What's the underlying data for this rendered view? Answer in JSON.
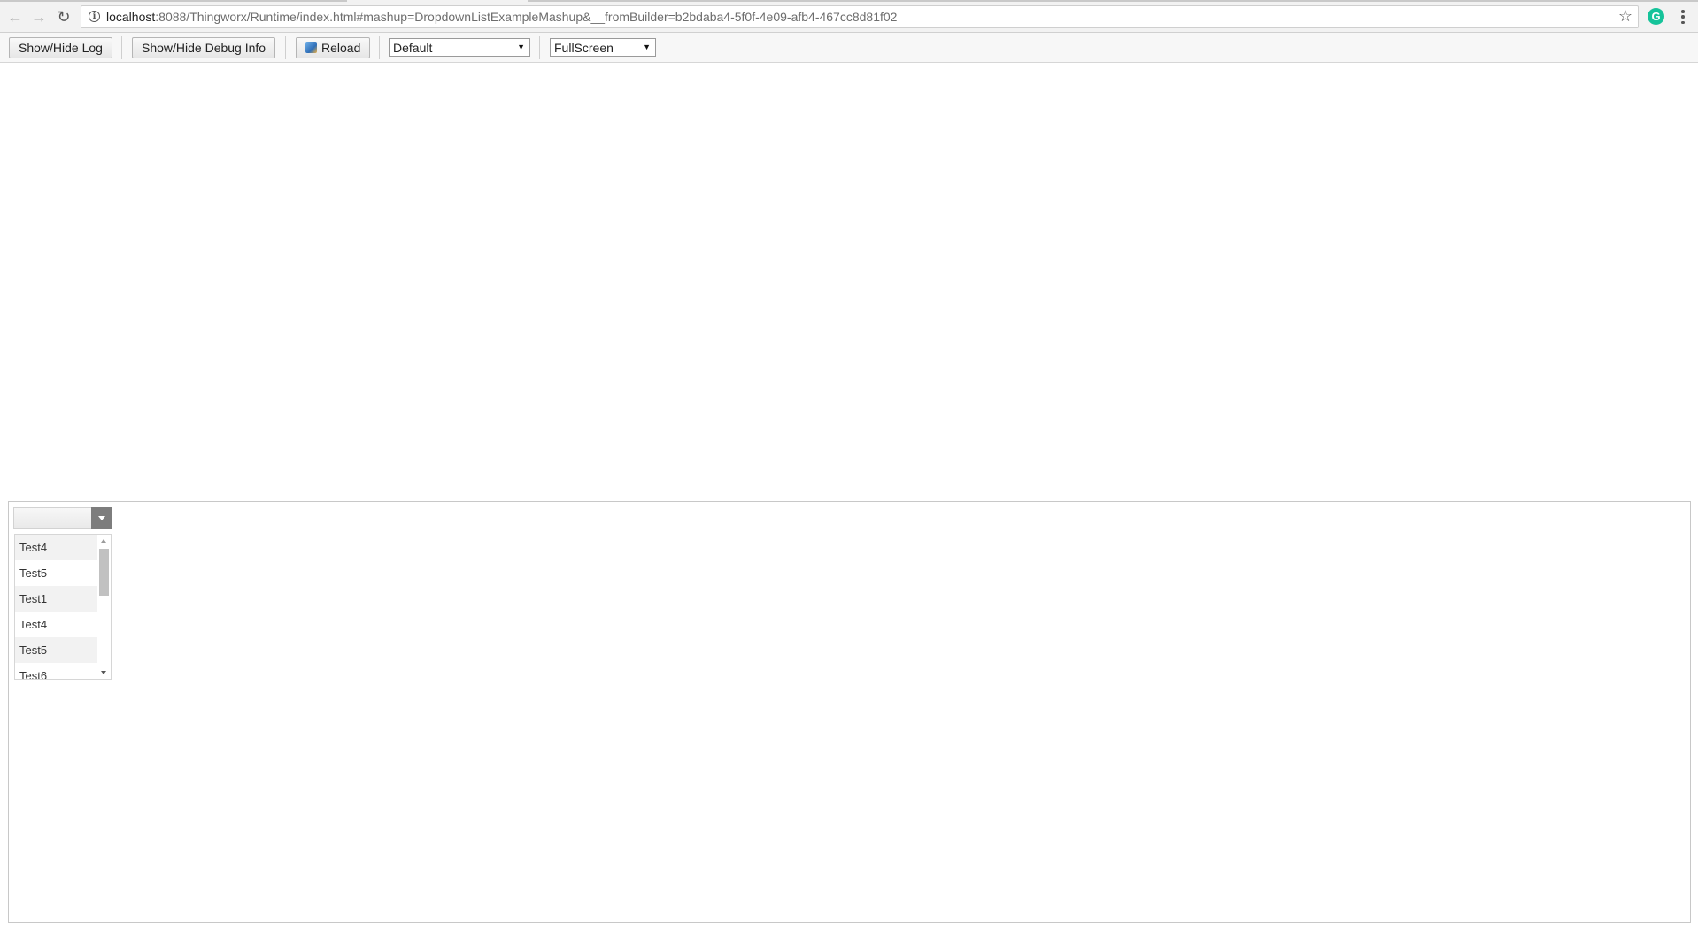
{
  "browser": {
    "url_host": "localhost",
    "url_path": ":8088/Thingworx/Runtime/index.html#mashup=DropdownListExampleMashup&__fromBuilder=b2bdaba4-5f0f-4e09-afb4-467cc8d81f02",
    "back_glyph": "←",
    "forward_glyph": "→",
    "reload_glyph": "↻",
    "star_glyph": "☆",
    "extension_letter": "G",
    "info_glyph": "i"
  },
  "toolbar": {
    "show_hide_log": "Show/Hide Log",
    "show_hide_debug": "Show/Hide Debug Info",
    "reload": "Reload",
    "theme_select": "Default",
    "view_select": "FullScreen"
  },
  "dropdown": {
    "selected_value": "",
    "items": [
      "Test4",
      "Test5",
      "Test1",
      "Test4",
      "Test5",
      "Test6"
    ]
  },
  "colors": {
    "grammarly": "#15c39a",
    "dropdown_button": "#7d7d7d"
  }
}
